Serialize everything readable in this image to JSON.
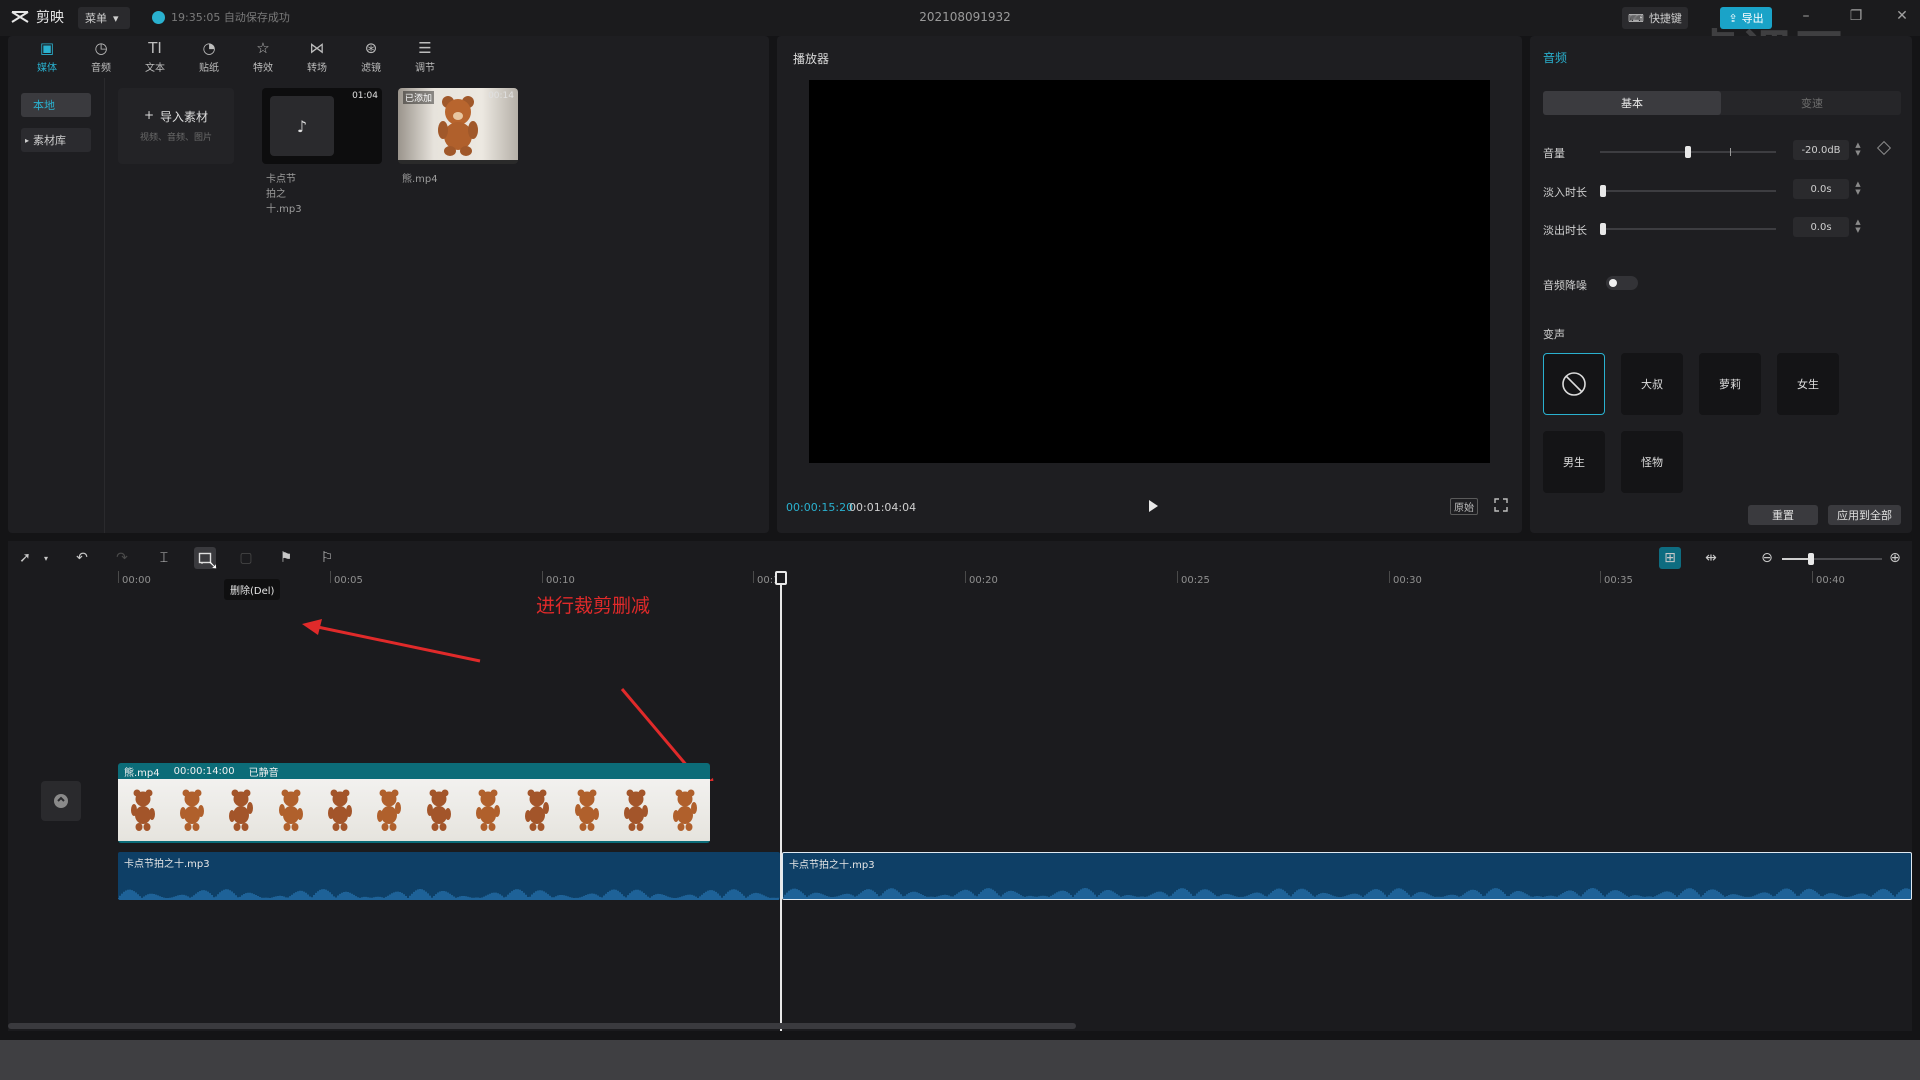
{
  "app": {
    "name": "剪映",
    "menu_label": "菜单",
    "autosave": "19:35:05 自动保存成功",
    "doc_title": "202108091932",
    "shortcut_label": "快捷键",
    "export_label": "导出",
    "watermark": "虎课网"
  },
  "media_toolbar": [
    {
      "label": "媒体",
      "icon": "media-icon"
    },
    {
      "label": "音频",
      "icon": "audio-icon"
    },
    {
      "label": "文本",
      "icon": "text-icon"
    },
    {
      "label": "贴纸",
      "icon": "sticker-icon"
    },
    {
      "label": "特效",
      "icon": "effects-icon"
    },
    {
      "label": "转场",
      "icon": "transition-icon"
    },
    {
      "label": "滤镜",
      "icon": "filter-icon"
    },
    {
      "label": "调节",
      "icon": "adjust-icon"
    }
  ],
  "media_sidebar": {
    "local": "本地",
    "library": "素材库"
  },
  "media": {
    "import_label": "导入素材",
    "import_hint": "视频、音频、图片",
    "items": [
      {
        "name": "卡点节拍之十.mp3",
        "duration": "01:04",
        "badge": ""
      },
      {
        "name": "熊.mp4",
        "duration": "00:14",
        "badge": "已添加"
      }
    ]
  },
  "player": {
    "title": "播放器",
    "current_time": "00:00:15:20",
    "total_time": "00:01:04:04",
    "ratio_label": "原始"
  },
  "audio_panel": {
    "title": "音频",
    "tabs": [
      "基本",
      "变速"
    ],
    "volume_label": "音量",
    "volume_value": "-20.0dB",
    "volume_level": 0.5,
    "fadein_label": "淡入时长",
    "fadein_value": "0.0s",
    "fadeout_label": "淡出时长",
    "fadeout_value": "0.0s",
    "denoise_label": "音频降噪",
    "voice_label": "变声",
    "voices": [
      "无",
      "大叔",
      "萝莉",
      "女生",
      "男生",
      "怪物"
    ],
    "reset_label": "重置",
    "apply_all_label": "应用到全部"
  },
  "timeline": {
    "tooltip": "删除(Del)",
    "annotation": "进行裁剪删减",
    "ruler": [
      "00:00",
      "00:05",
      "00:10",
      "00:15",
      "00:20",
      "00:25",
      "00:30",
      "00:35",
      "00:40"
    ],
    "video_clip": {
      "name": "熊.mp4",
      "duration": "00:00:14:00",
      "status": "已静音"
    },
    "audio_clip_left": "卡点节拍之十.mp3",
    "audio_clip_right": "卡点节拍之十.mp3"
  },
  "colors": {
    "accent": "#2ab1cf",
    "annotation": "#e02a2a",
    "video_clip": "#0c6c78",
    "audio_clip": "#0e3f66"
  }
}
